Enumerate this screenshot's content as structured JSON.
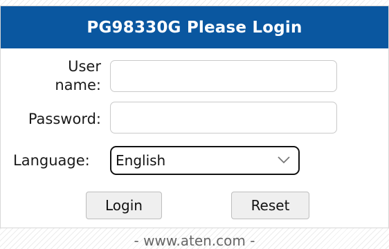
{
  "header": {
    "title": "PG98330G Please Login"
  },
  "form": {
    "username_label_line1": "User",
    "username_label_line2": "name:",
    "username_value": "",
    "password_label": "Password:",
    "password_value": "",
    "language_label": "Language:",
    "language_selected": "English"
  },
  "buttons": {
    "login": "Login",
    "reset": "Reset"
  },
  "footer": {
    "text": "- www.aten.com -"
  },
  "colors": {
    "header_bg": "#0a57a0",
    "header_text": "#ffffff"
  },
  "icons": {
    "select_arrow": "chevron-down-icon"
  }
}
